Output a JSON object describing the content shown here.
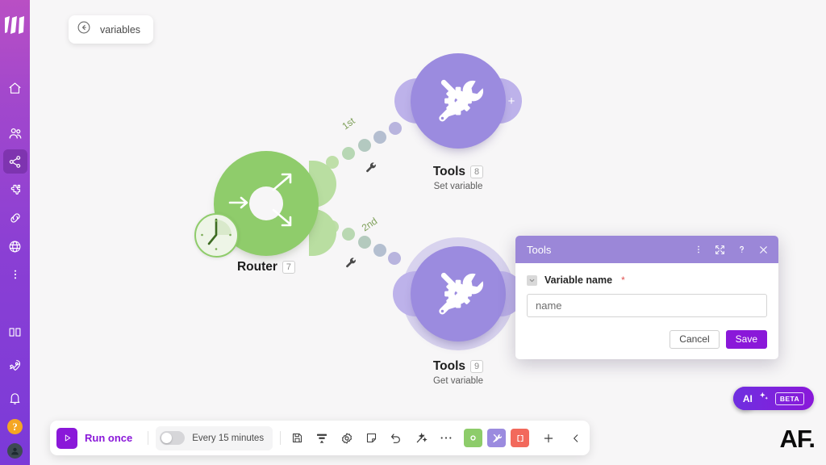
{
  "app": {
    "logo": "make-logo",
    "watermark": "AF."
  },
  "sidebar": {
    "top_items": [
      {
        "icon": "home-icon",
        "name": "home"
      },
      {
        "icon": "team-icon",
        "name": "team"
      },
      {
        "icon": "scenarios-icon",
        "name": "scenarios",
        "active": true
      },
      {
        "icon": "puzzle-icon",
        "name": "templates"
      },
      {
        "icon": "connections-icon",
        "name": "connections"
      },
      {
        "icon": "globe-icon",
        "name": "webhooks"
      },
      {
        "icon": "more-vertical-icon",
        "name": "more"
      }
    ],
    "bottom_items": [
      {
        "icon": "book-icon",
        "name": "docs"
      },
      {
        "icon": "rocket-icon",
        "name": "whats-new"
      },
      {
        "icon": "bell-icon",
        "name": "notifications"
      },
      {
        "icon": "help-icon",
        "name": "help",
        "label": "?"
      },
      {
        "icon": "avatar-icon",
        "name": "profile"
      }
    ]
  },
  "breadcrumb": {
    "back_icon": "back-arrow-icon",
    "label": "variables"
  },
  "flow": {
    "nodes": [
      {
        "id": "router",
        "title": "Router",
        "badge": "7",
        "subtitle": "",
        "color": "#8fcc6b",
        "icon": "router-icon",
        "has_clock": true
      },
      {
        "id": "tools-8",
        "title": "Tools",
        "badge": "8",
        "subtitle": "Set variable",
        "color": "#9b8bdf",
        "icon": "tools-icon",
        "selected": false
      },
      {
        "id": "tools-9",
        "title": "Tools",
        "badge": "9",
        "subtitle": "Get variable",
        "color": "#9b8bdf",
        "icon": "tools-icon",
        "selected": true
      }
    ],
    "connectors": [
      {
        "label": "1st",
        "from": "router",
        "to": "tools-8",
        "color": "#7fa05a"
      },
      {
        "label": "2nd",
        "from": "router",
        "to": "tools-9",
        "color": "#7fa05a"
      }
    ],
    "add_module_icon": "plus-icon"
  },
  "modal": {
    "title": "Tools",
    "header_icons": [
      {
        "icon": "kebab-menu-icon",
        "name": "modal-menu"
      },
      {
        "icon": "expand-icon",
        "name": "modal-expand"
      },
      {
        "icon": "help-icon",
        "name": "modal-help"
      },
      {
        "icon": "close-icon",
        "name": "modal-close"
      }
    ],
    "field": {
      "label": "Variable name",
      "required_marker": "*",
      "toggle_icon": "chevron-down-icon",
      "value": "name",
      "placeholder": "name"
    },
    "buttons": {
      "cancel": "Cancel",
      "save": "Save"
    }
  },
  "toolbar": {
    "run_label": "Run once",
    "run_icon": "play-icon",
    "schedule_label": "Every 15 minutes",
    "schedule_enabled": false,
    "icons": [
      {
        "icon": "save-icon",
        "name": "save"
      },
      {
        "icon": "align-icon",
        "name": "auto-align"
      },
      {
        "icon": "settings-gear-icon",
        "name": "settings"
      },
      {
        "icon": "note-icon",
        "name": "notes"
      },
      {
        "icon": "undo-icon",
        "name": "undo"
      },
      {
        "icon": "magic-wand-icon",
        "name": "auto-align-magic"
      },
      {
        "icon": "ellipsis-icon",
        "name": "more-options"
      }
    ],
    "chips": [
      {
        "name": "router-chip",
        "color": "#8dcc6a",
        "icon": "router-icon"
      },
      {
        "name": "tools-chip",
        "color": "#9b8bdf",
        "icon": "tools-icon"
      },
      {
        "name": "bracket-chip",
        "color": "#f2695c",
        "icon": "bracket-icon"
      }
    ],
    "end_icons": [
      {
        "icon": "plus-icon",
        "name": "add-module"
      },
      {
        "icon": "chevron-left-icon",
        "name": "collapse-panel"
      }
    ]
  },
  "widgets": {
    "hint_icon": "lightbulb-icon",
    "ai_label": "AI",
    "ai_sparkle_icon": "sparkle-icon",
    "ai_badge": "BETA"
  }
}
